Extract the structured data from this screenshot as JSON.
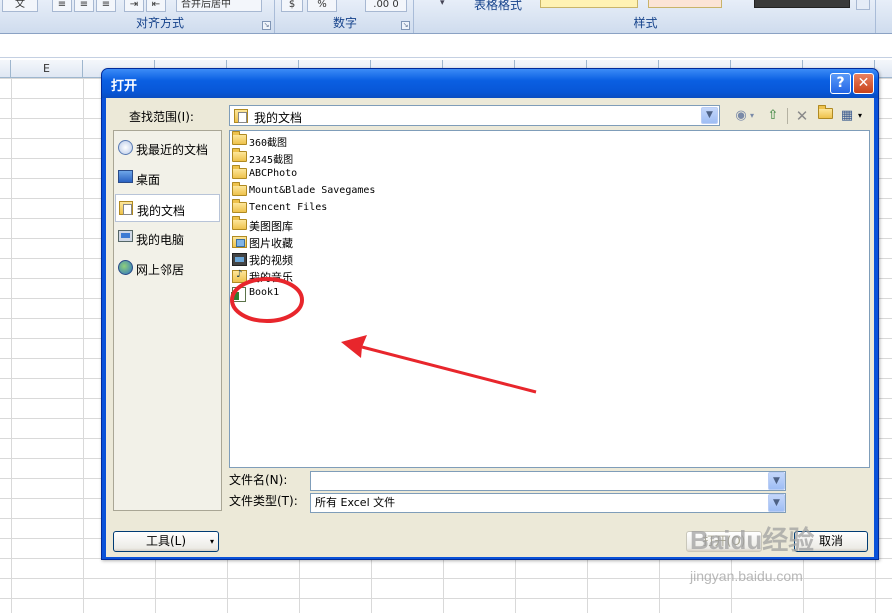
{
  "ribbon": {
    "groups": [
      {
        "label": "对齐方式"
      },
      {
        "label": "数字"
      },
      {
        "label": "样式"
      }
    ],
    "table_format_label": "表格格式",
    "fragments": {
      "wrap": "文",
      "merge": "合并后居中",
      "percent": "%",
      "decimals": ".00 0"
    }
  },
  "sheet": {
    "visible_column": "E"
  },
  "dialog": {
    "title": "打开",
    "help_glyph": "?",
    "close_glyph": "✕",
    "lookin_label": "查找范围(I):",
    "lookin_value": "我的文档",
    "places": [
      {
        "label": "我最近的文档",
        "icon": "recent-documents-icon"
      },
      {
        "label": "桌面",
        "icon": "desktop-icon"
      },
      {
        "label": "我的文档",
        "icon": "my-documents-icon",
        "selected": true
      },
      {
        "label": "我的电脑",
        "icon": "my-computer-icon"
      },
      {
        "label": "网上邻居",
        "icon": "network-places-icon"
      }
    ],
    "files": [
      {
        "name": "360截图",
        "icon": "folder-icon"
      },
      {
        "name": "2345截图",
        "icon": "folder-icon"
      },
      {
        "name": "ABCPhoto",
        "icon": "folder-icon"
      },
      {
        "name": "Mount&Blade Savegames",
        "icon": "folder-icon"
      },
      {
        "name": "Tencent Files",
        "icon": "folder-icon"
      },
      {
        "name": "美图图库",
        "icon": "folder-icon"
      },
      {
        "name": "图片收藏",
        "icon": "picture-folder-icon"
      },
      {
        "name": "我的视频",
        "icon": "video-folder-icon"
      },
      {
        "name": "我的音乐",
        "icon": "music-folder-icon"
      },
      {
        "name": "Book1",
        "icon": "excel-file-icon"
      }
    ],
    "filename_label": "文件名(N):",
    "filename_value": "",
    "filetype_label": "文件类型(T):",
    "filetype_value": "所有 Excel 文件",
    "tools_button": "工具(L)",
    "open_button": "打开(O)",
    "cancel_button": "取消"
  },
  "watermark": {
    "brand": "Baidu经验",
    "url": "jingyan.baidu.com"
  },
  "colors": {
    "title_blue": "#0a52d9",
    "dialog_face": "#ece9d8",
    "annotation_red": "#e8262c"
  }
}
